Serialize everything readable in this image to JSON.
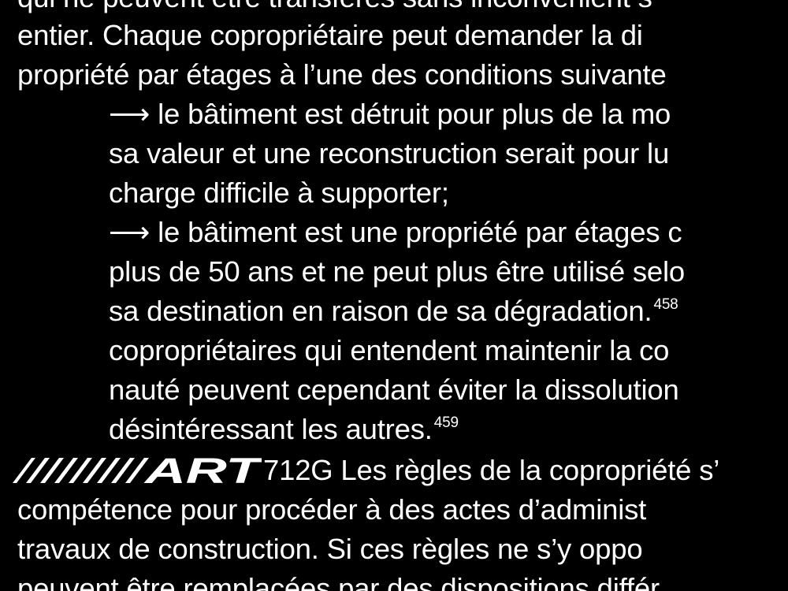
{
  "lines": [
    "qui ne peuvent être transférés sans inconvénient s",
    "entier. Chaque copropriétaire peut demander la di",
    "propriété par étages à l’une des conditions suivante",
    "le bâtiment est détruit pour plus de la mo",
    "sa valeur et une reconstruction serait pour lu",
    "charge difficile à supporter;",
    "le bâtiment est une propriété par étages c",
    "plus de 50 ans et ne peut plus être utilisé selo",
    "sa destination en raison de sa dégradation.",
    "copropriétaires qui entendent maintenir la co",
    "nauté peuvent cependant éviter la dissolution",
    "désintéressant les autres.",
    "712G Les règles de la copropriété s’",
    "compétence pour procéder à des actes d’administ",
    "travaux de construction. Si ces règles ne s’y oppo",
    "peuvent être remplacées par des dispositions différ"
  ],
  "arrow_glyph": "⟶",
  "footnotes": {
    "fn_458": "458",
    "fn_459": "459"
  },
  "article_logo": {
    "text": "ART",
    "icon": "art-slash-logo-icon"
  },
  "colors": {
    "background": "#000000",
    "text": "#ffffff"
  }
}
